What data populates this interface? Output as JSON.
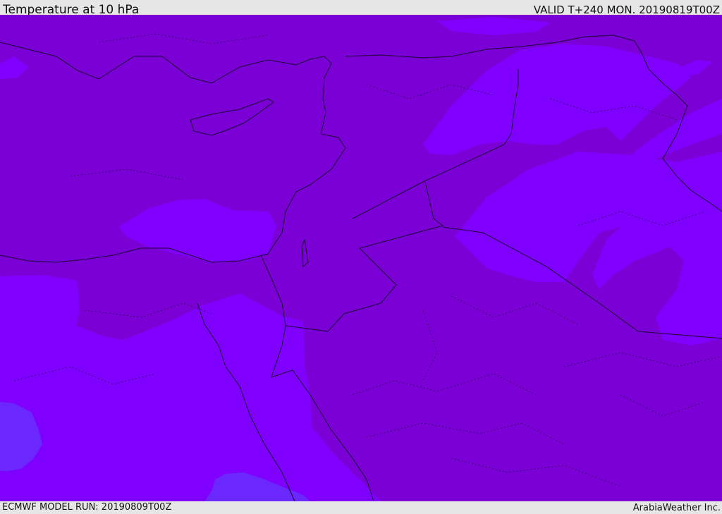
{
  "header": {
    "title": "Temperature at 10 hPa",
    "valid": "VALID T+240 MON. 20190819T00Z"
  },
  "footer": {
    "model_run": "ECMWF MODEL RUN: 20190809T00Z",
    "credit": "ArabiaWeather Inc."
  },
  "colors": {
    "dark_band": "#7a00d6",
    "mid_band": "#7f00fe",
    "light_band": "#6a28ff",
    "border_line": "#1a0033",
    "background": "#e6e6e6"
  }
}
